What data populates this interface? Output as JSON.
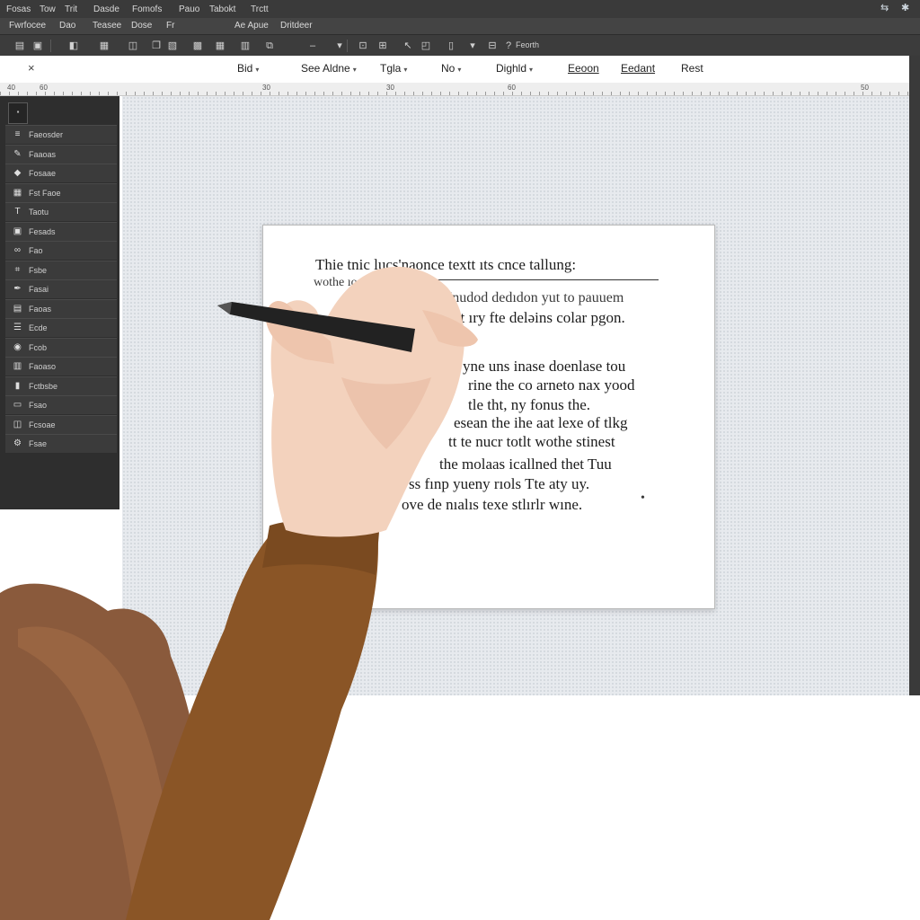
{
  "menu": {
    "items": [
      "Fosas",
      "Tow",
      "Trit",
      "Dasde",
      "Fomofs",
      "Pauo",
      "Tabokt",
      "Trctt"
    ]
  },
  "toolbar1": {
    "items": [
      "Fwrfocee",
      "Dao",
      "Teasee",
      "Dose",
      "Fr",
      "Ae Apue",
      "Dritdeer"
    ]
  },
  "toolbar2": {
    "search_label": "Feorth"
  },
  "ribbon": {
    "close_glyph": "×",
    "items": [
      {
        "label": "Bid",
        "has_caret": true
      },
      {
        "label": "See Aldne",
        "has_caret": true
      },
      {
        "label": "Tgla",
        "has_caret": true
      },
      {
        "label": "No",
        "has_caret": true
      },
      {
        "label": "Dighld",
        "has_caret": true
      },
      {
        "label": "Eeoon",
        "has_caret": false
      },
      {
        "label": "Eedant",
        "has_caret": false
      },
      {
        "label": "Rest",
        "has_caret": false
      }
    ]
  },
  "ruler": {
    "numbers": [
      "40",
      "60",
      "30",
      "30",
      "60",
      "50"
    ]
  },
  "left_panel": {
    "items": [
      {
        "icon": "layers-icon",
        "label": "Faeosder"
      },
      {
        "icon": "brush-icon",
        "label": "Faaoas"
      },
      {
        "icon": "shape-icon",
        "label": "Fosaae"
      },
      {
        "icon": "grid-icon",
        "label": "Fst Faoe"
      },
      {
        "icon": "text-icon",
        "label": "Taotu"
      },
      {
        "icon": "image-icon",
        "label": "Fesads"
      },
      {
        "icon": "link-icon",
        "label": "Fao"
      },
      {
        "icon": "crop-icon",
        "label": "Fsbe"
      },
      {
        "icon": "pen-icon",
        "label": "Fasai"
      },
      {
        "icon": "doc-icon",
        "label": "Faoas"
      },
      {
        "icon": "list-icon",
        "label": "Ecde"
      },
      {
        "icon": "bucket-icon",
        "label": "Fcob"
      },
      {
        "icon": "table-icon",
        "label": "Faoaso"
      },
      {
        "icon": "chart-icon",
        "label": "Fctbsbe"
      },
      {
        "icon": "folder-icon",
        "label": "Fsao"
      },
      {
        "icon": "folder-open-icon",
        "label": "Fcsoae"
      },
      {
        "icon": "settings-icon",
        "label": "Fsae"
      }
    ]
  },
  "document": {
    "lines": [
      "Thie tnic    lucs'naonce textt ıts cnce tallung:",
      "wothe          ıo dıhon ıeiıhnce",
      "Mnudod dedıdon yut to pauuem",
      "ct ıry fte deləins colar pgon.",
      "yne uns inase doenlase tou",
      "rine the co arneto nax yood",
      "tle tht, ny fonus the.",
      "esean the ihe aat lexe of tlkg",
      "tt te nucr totlt wothe stinest",
      "the molaas icallned thet Tuu",
      "ss fınp yueny rıols Tte aty uy.",
      "ove de nıalıs texe stlırlr wıne.",
      "•"
    ]
  },
  "colors": {
    "chrome_dark": "#3a3a3a",
    "workspace_bg": "#e7eaee",
    "sweater": "#8a5526",
    "hair": "#8a5a3c",
    "skin": "#f3d2bd",
    "pen": "#222222"
  }
}
